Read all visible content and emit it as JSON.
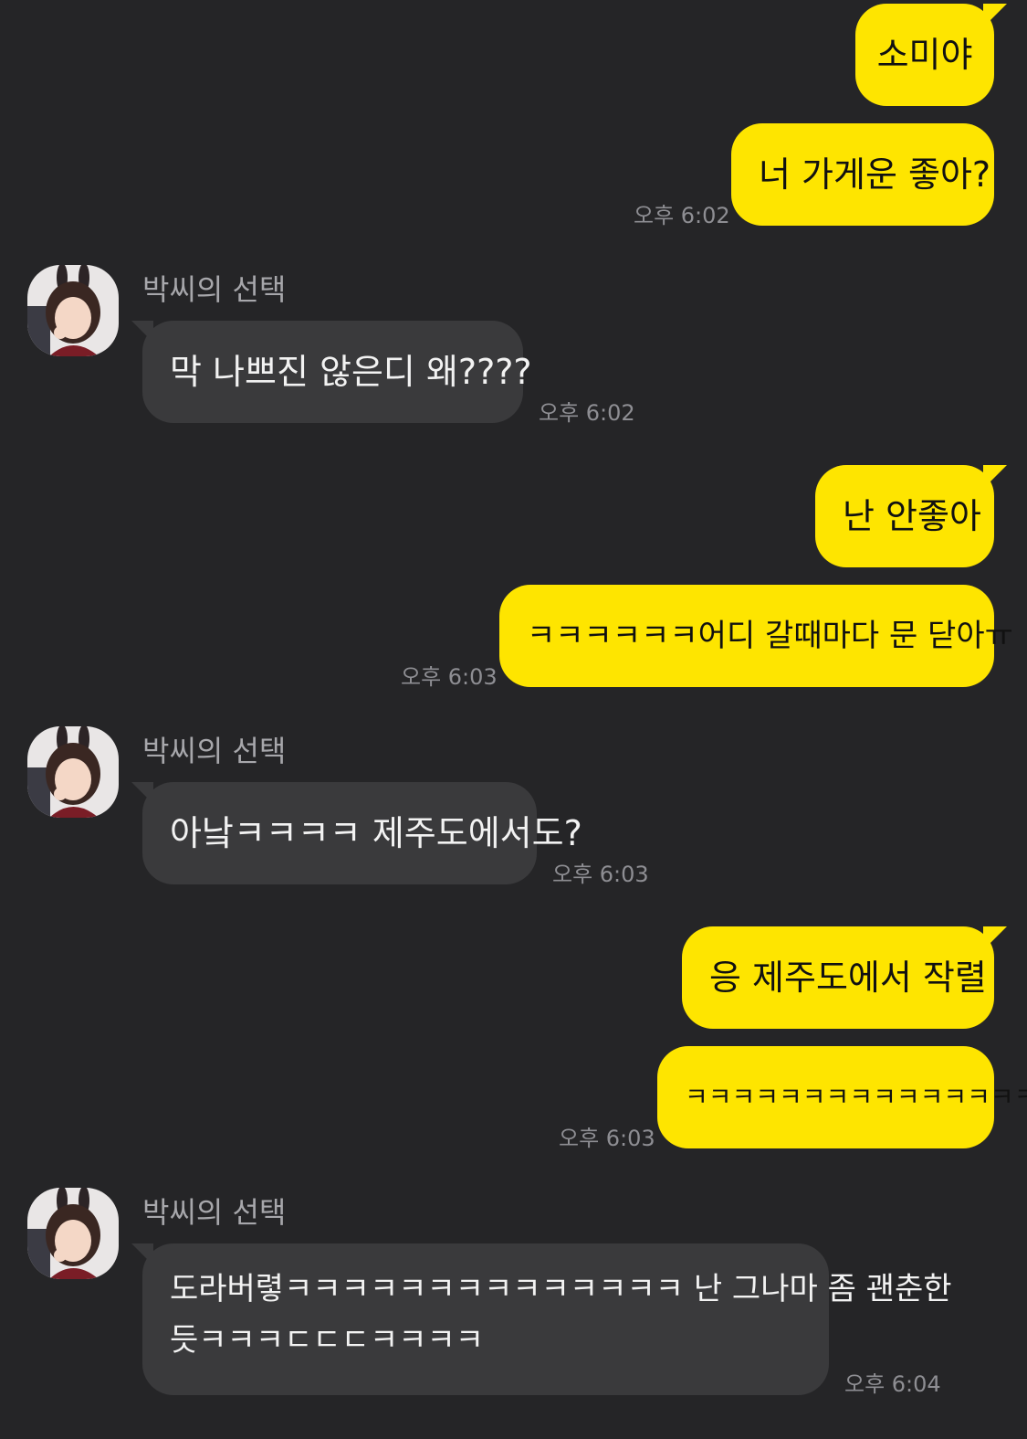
{
  "contact": {
    "name": "박씨의 선택"
  },
  "messages": [
    {
      "sender": "me",
      "text": "소미야"
    },
    {
      "sender": "me",
      "text": "너 가게운 좋아?",
      "time": "오후 6:02"
    },
    {
      "sender": "other",
      "text": "막 나쁘진 않은디 왜????",
      "time": "오후 6:02"
    },
    {
      "sender": "me",
      "text": "난 안좋아"
    },
    {
      "sender": "me",
      "text": "ㅋㅋㅋㅋㅋㅋ어디 갈때마다 문 닫아ㅠ",
      "time": "오후 6:03"
    },
    {
      "sender": "other",
      "text": "아낰ㅋㅋㅋㅋ 제주도에서도?",
      "time": "오후 6:03"
    },
    {
      "sender": "me",
      "text": "응 제주도에서 작렬"
    },
    {
      "sender": "me",
      "text": "ㅋㅋㅋㅋㅋㅋㅋㅋㅋㅋㅋㅋㅋㅋㅋㅋ",
      "time": "오후 6:03"
    },
    {
      "sender": "other",
      "text_line1": "도라버렿ㅋㅋㅋㅋㅋㅋㅋㅋㅋㅋㅋㅋㅋㅋ 난 그나마 좀 괜춘한",
      "text_line2": "듯ㅋㅋㅋㄷㄷㄷㅋㅋㅋㅋ",
      "time": "오후 6:04"
    }
  ]
}
